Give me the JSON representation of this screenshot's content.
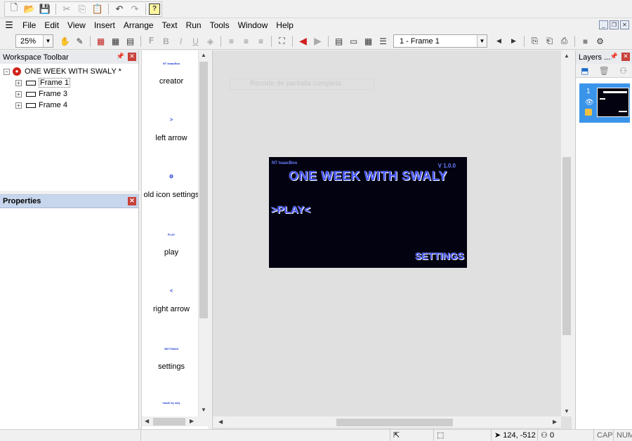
{
  "menu": [
    "File",
    "Edit",
    "View",
    "Insert",
    "Arrange",
    "Text",
    "Run",
    "Tools",
    "Window",
    "Help"
  ],
  "toolbar2": {
    "zoom": "25%",
    "frame_select": "1 - Frame 1"
  },
  "workspace": {
    "title": "Workspace Toolbar",
    "project": "ONE WEEK WITH SWALY *",
    "frames": [
      "Frame 1",
      "Frame 3",
      "Frame 4"
    ]
  },
  "properties": {
    "title": "Properties"
  },
  "library": {
    "items": [
      {
        "thumb": "NT IsaacBoo",
        "label": "creator"
      },
      {
        "thumb": ">",
        "label": "left arrow"
      },
      {
        "thumb": "⚙",
        "label": "old icon settings"
      },
      {
        "thumb": "PLAY",
        "label": "play"
      },
      {
        "thumb": "<",
        "label": "right arrow"
      },
      {
        "thumb": "SETTINGS",
        "label": "settings"
      },
      {
        "thumb": "made by swy",
        "label": ""
      }
    ]
  },
  "canvas": {
    "ghost_text": "Recorte de pantalla completa",
    "game": {
      "tag": "NT IsaacBoo",
      "version": "V 1.0.0",
      "title": "ONE WEEK WITH SWALY",
      "play": ">PLAY<",
      "settings": "SETTINGS"
    }
  },
  "layers": {
    "title": "Layers ...",
    "layer_number": "1"
  },
  "status": {
    "coords": "124, -512",
    "objects": "0",
    "cap": "CAP",
    "num": "NUM"
  },
  "colors": {
    "stage_bg": "#020210",
    "game_text": "#4456ff",
    "layer_selected": "#3a94ea",
    "properties_header": "#c7d6ec",
    "close_red": "#c8413a"
  }
}
